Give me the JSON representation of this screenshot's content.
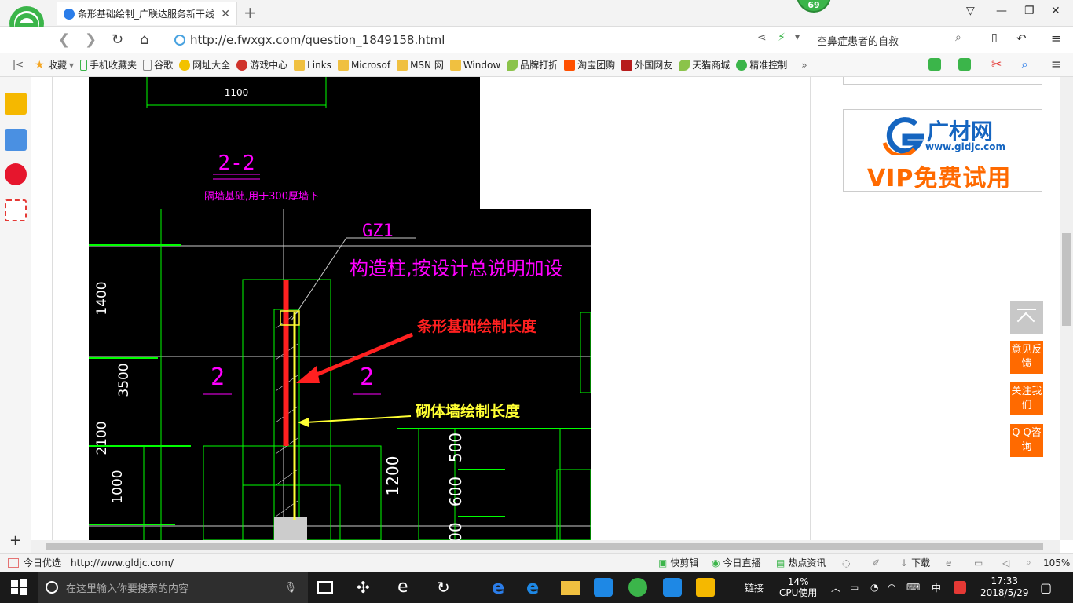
{
  "browser": {
    "tab_title": "条形基础绘制_广联达服务新干线",
    "badge_count": "69",
    "url": "http://e.fwxgx.com/question_1849158.html",
    "search_text": "空鼻症患者的自救"
  },
  "bookmarks": [
    "收藏",
    "手机收藏夹",
    "谷歌",
    "网址大全",
    "游戏中心",
    "Links",
    "Microsof",
    "MSN 网",
    "Window",
    "品牌打折",
    "淘宝团购",
    "外国网友",
    "天猫商城",
    "精准控制"
  ],
  "cad": {
    "dim_top": "1100",
    "section_label": "2-2",
    "section_note": "隔墙基础,用于300厚墙下",
    "gz_label": "GZ1",
    "gz_note": "构造柱,按设计总说明加设",
    "dims_left": [
      "1400",
      "3500",
      "2100",
      "1000"
    ],
    "dims_right": [
      "1200",
      "600",
      "500",
      "00"
    ],
    "label_2a": "2",
    "label_2b": "2",
    "red_annotation": "条形基础绘制长度",
    "yellow_annotation": "砌体墙绘制长度"
  },
  "ad": {
    "brand": "广材网",
    "site": "www.gldjc.com",
    "promo": "VIP免费试用"
  },
  "float_buttons": {
    "feedback": "意见反馈",
    "follow": "关注我们",
    "qq": "Q Q咨询"
  },
  "statusbar": {
    "left_label": "今日优选",
    "hover_url": "http://www.gldjc.com/",
    "items": [
      "快剪辑",
      "今日直播",
      "热点资讯",
      "下载"
    ],
    "zoom": "105%"
  },
  "taskbar": {
    "search_placeholder": "在这里输入你要搜索的内容",
    "link_label": "链接",
    "cpu_percent": "14%",
    "cpu_label": "CPU使用",
    "ime": "中",
    "time": "17:33",
    "date": "2018/5/29"
  },
  "colors": {
    "accent_green": "#3bb54a",
    "cad_green": "#00ff00",
    "cad_magenta": "#ff00ff",
    "annotation_red": "#ff2020",
    "annotation_yellow": "#ffff33",
    "float_orange": "#ff6a00"
  }
}
